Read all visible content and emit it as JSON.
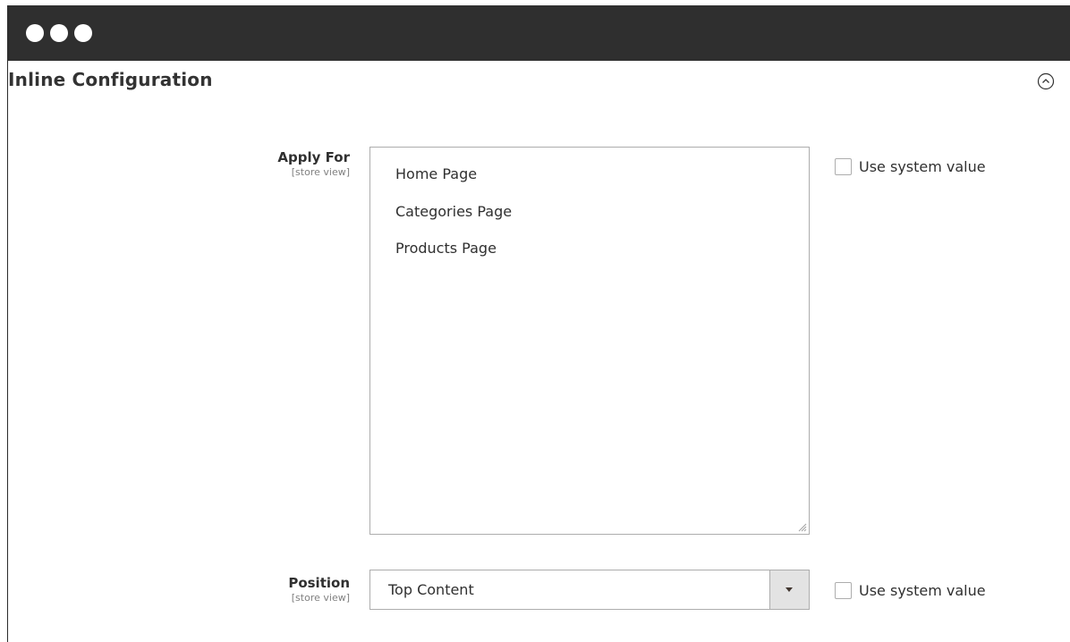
{
  "section": {
    "title": "Inline Configuration",
    "collapse_icon": "chevron-up-circle-icon"
  },
  "fields": {
    "apply_for": {
      "label": "Apply For",
      "scope": "[store view]",
      "options": [
        "Home Page",
        "Categories Page",
        "Products Page"
      ],
      "use_system_value_label": "Use system value",
      "use_system_value_checked": false
    },
    "position": {
      "label": "Position",
      "scope": "[store view]",
      "selected": "Top Content",
      "use_system_value_label": "Use system value",
      "use_system_value_checked": false
    }
  },
  "colors": {
    "titlebar": "#2f2f2f",
    "border": "#adadad",
    "select_arrow_bg": "#e3e3e3"
  }
}
